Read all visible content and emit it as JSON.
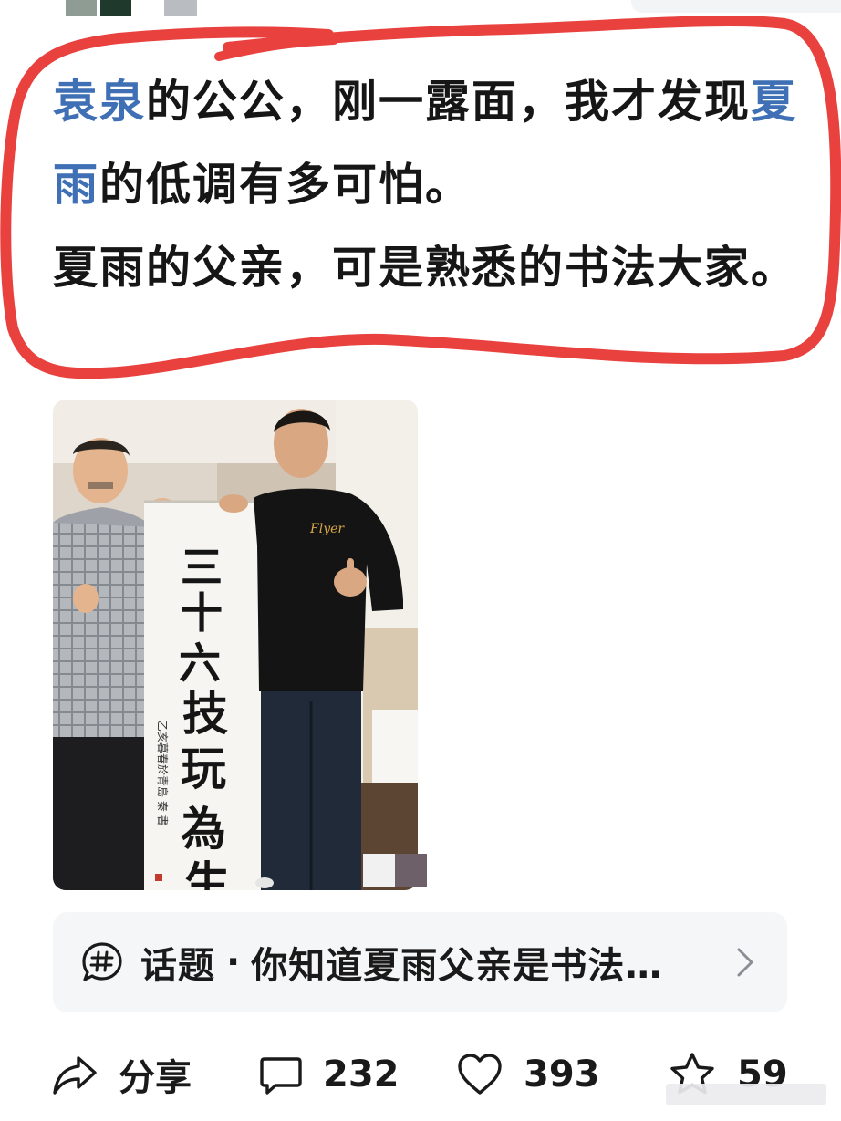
{
  "post": {
    "mention_1": "袁泉",
    "text_1": "的公公，刚一露面，我才发现",
    "mention_2": "夏雨",
    "text_2": "的低调有多可怕。",
    "text_3": "夏雨的父亲，可是熟悉的书法大家。"
  },
  "photo": {
    "calligraphy_lines": [
      "三",
      "十",
      "六",
      "技",
      "玩",
      "為",
      "生"
    ],
    "calligraphy_inscription": "乙亥暮春於青島 秦 書",
    "shirt_logo": "Flyer"
  },
  "topic": {
    "icon": "hashtag-icon",
    "label": "话题",
    "separator": "·",
    "title": "你知道夏雨父亲是书法家吗",
    "chevron": "chevron-right-icon"
  },
  "actions": {
    "share": {
      "icon": "share-icon",
      "label": "分享"
    },
    "comment": {
      "icon": "comment-icon",
      "count": "232"
    },
    "like": {
      "icon": "heart-icon",
      "count": "393"
    },
    "favorite": {
      "icon": "star-icon",
      "count": "59"
    }
  },
  "colors": {
    "mention": "#3f6fb5",
    "annotation": "#e8413e",
    "card_bg": "#f5f6f8"
  }
}
